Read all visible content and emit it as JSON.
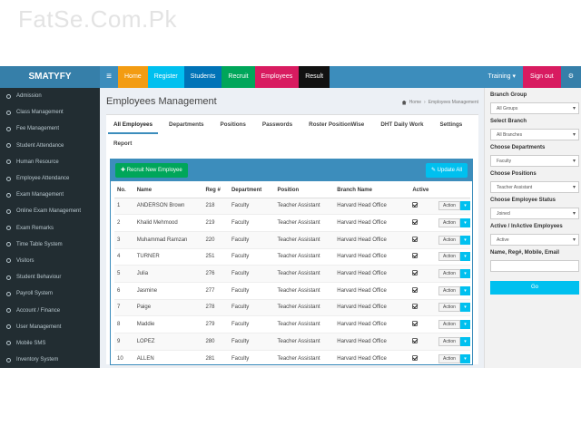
{
  "watermark": "FatSe.Com.Pk",
  "brand": "SMATYFY",
  "menu_toggle": "≡",
  "topnav": [
    {
      "label": "Home",
      "color": "#f39c12"
    },
    {
      "label": "Register",
      "color": "#00c0ef"
    },
    {
      "label": "Students",
      "color": "#0073b7"
    },
    {
      "label": "Recruit",
      "color": "#00a65a"
    },
    {
      "label": "Employees",
      "color": "#d81b60"
    },
    {
      "label": "Result",
      "color": "#111111"
    }
  ],
  "right_nav": {
    "training": "Training ▾",
    "sign_out": "Sign out",
    "gear": "⚙"
  },
  "sidebar": [
    "Admission",
    "Class Management",
    "Fee Management",
    "Student Attendance",
    "Human Resource",
    "Employee Attendance",
    "Exam Management",
    "Online Exam Management",
    "Exam Remarks",
    "Time Table System",
    "Visitors",
    "Student Behaviour",
    "Payroll System",
    "Account / Finance",
    "User Management",
    "Mobile SMS",
    "Inventory System"
  ],
  "page": {
    "title": "Employees Management",
    "breadcrumb_home": "Home",
    "breadcrumb_current": "Employees Management"
  },
  "tabs": [
    "All Employees",
    "Departments",
    "Positions",
    "Passwords",
    "Roster PositionWise",
    "DHT Daily Work",
    "Settings",
    "Report"
  ],
  "panel": {
    "recruit_button": "✚ Recruit New Employee",
    "update_button": "✎ Update All",
    "columns": [
      "No.",
      "Name",
      "Reg #",
      "Department",
      "Position",
      "Branch Name",
      "Active",
      ""
    ],
    "action_label": "Action",
    "rows": [
      [
        "1",
        "ANDERSON Brown",
        "218",
        "Faculty",
        "Teacher Assistant",
        "Harvard Head Office"
      ],
      [
        "2",
        "Khalid Mehmood",
        "219",
        "Faculty",
        "Teacher Assistant",
        "Harvard Head Office"
      ],
      [
        "3",
        "Muhammad Ramzan",
        "220",
        "Faculty",
        "Teacher Assistant",
        "Harvard Head Office"
      ],
      [
        "4",
        "TURNER",
        "251",
        "Faculty",
        "Teacher Assistant",
        "Harvard Head Office"
      ],
      [
        "5",
        "Julia",
        "276",
        "Faculty",
        "Teacher Assistant",
        "Harvard Head Office"
      ],
      [
        "6",
        "Jasmine",
        "277",
        "Faculty",
        "Teacher Assistant",
        "Harvard Head Office"
      ],
      [
        "7",
        "Paige",
        "278",
        "Faculty",
        "Teacher Assistant",
        "Harvard Head Office"
      ],
      [
        "8",
        "Maddie",
        "279",
        "Faculty",
        "Teacher Assistant",
        "Harvard Head Office"
      ],
      [
        "9",
        "LOPEZ",
        "280",
        "Faculty",
        "Teacher Assistant",
        "Harvard Head Office"
      ],
      [
        "10",
        "ALLEN",
        "281",
        "Faculty",
        "Teacher Assistant",
        "Harvard Head Office"
      ]
    ]
  },
  "filter": {
    "branch_group_label": "Branch Group",
    "branch_group_value": "All Groups",
    "select_branch_label": "Select Branch",
    "select_branch_value": "All Branches",
    "departments_label": "Choose Departments",
    "departments_value": "Faculty",
    "positions_label": "Choose Positions",
    "positions_value": "Teacher Assistant",
    "status_label": "Choose Employee Status",
    "status_value": "Joined",
    "active_label": "Active / InActive Employees",
    "active_value": "Active",
    "search_label": "Name, Reg#, Mobile, Email",
    "search_value": "",
    "go_button": "Go"
  }
}
